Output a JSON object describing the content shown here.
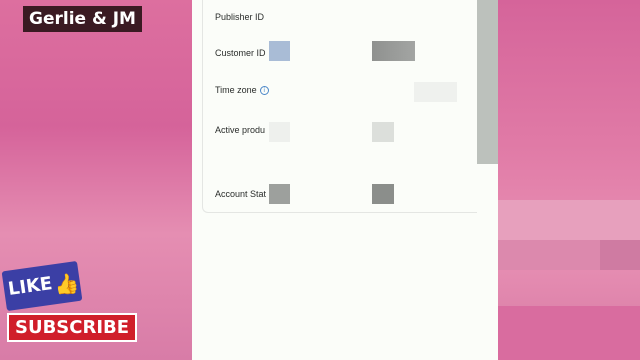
{
  "overlay": {
    "channel_name": "Gerlie & JM",
    "like_label": "LIKE",
    "thumb_glyph": "👍",
    "subscribe_label": "SUBSCRIBE"
  },
  "account_info": {
    "rows": [
      {
        "label": "Publisher ID"
      },
      {
        "label": "Customer ID"
      },
      {
        "label": "Time zone"
      },
      {
        "label": "Active produ"
      },
      {
        "label": "Account Stat"
      }
    ],
    "info_icon_glyph": "i"
  },
  "colors": {
    "background_pink": "#e2749f",
    "card_bg": "#fbfdf9",
    "scrollbar": "#bcc1bc",
    "subscribe_red": "#d01e2a",
    "like_blue": "#3b3fa5"
  }
}
